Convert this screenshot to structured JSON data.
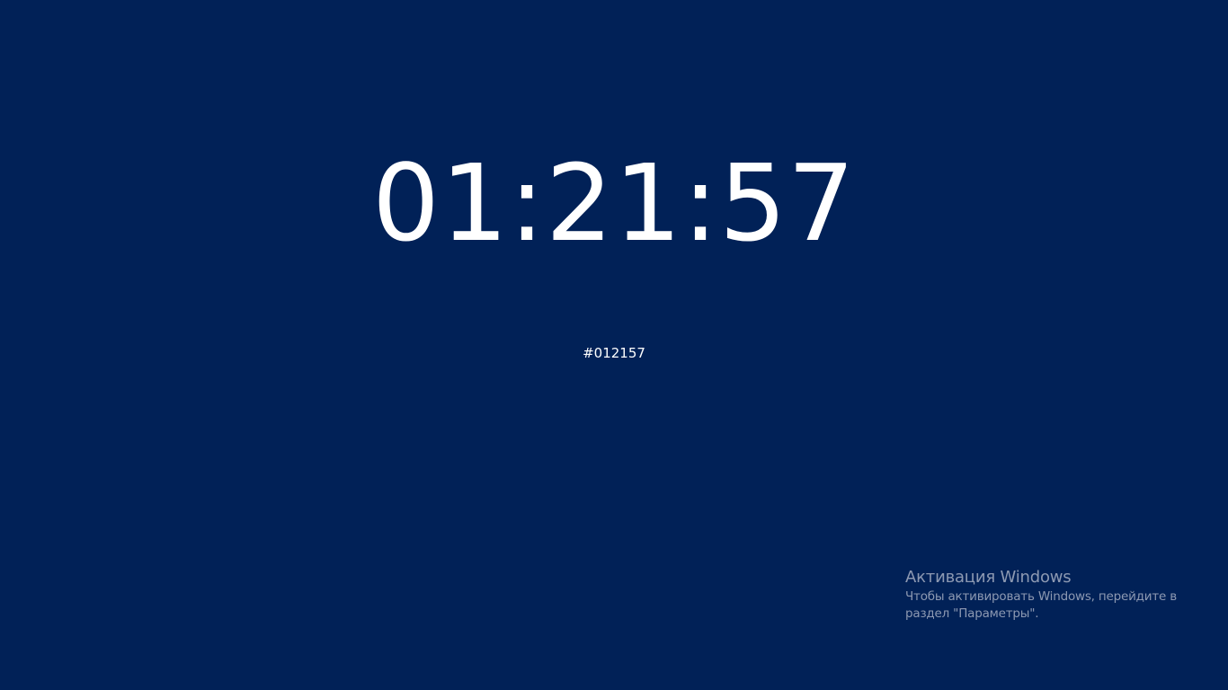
{
  "clock": {
    "time": "01:21:57"
  },
  "color_code": {
    "hex_label": "#012157"
  },
  "colors": {
    "background": "#012157",
    "text": "#ffffff",
    "watermark": "#8d99b2"
  },
  "activation_watermark": {
    "title": "Активация Windows",
    "line1": "Чтобы активировать Windows, перейдите в",
    "line2": "раздел \"Параметры\"."
  }
}
